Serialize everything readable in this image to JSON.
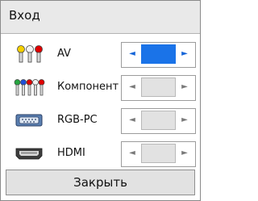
{
  "dialog": {
    "title": "Вход",
    "close_label": "Закрыть"
  },
  "inputs": [
    {
      "label": "AV",
      "icon": "av-plugs-icon",
      "selected": true
    },
    {
      "label": "Компонент",
      "icon": "component-plugs-icon",
      "selected": false
    },
    {
      "label": "RGB-PC",
      "icon": "vga-port-icon",
      "selected": false
    },
    {
      "label": "HDMI",
      "icon": "hdmi-port-icon",
      "selected": false
    }
  ],
  "arrows": {
    "left": "◄",
    "right": "►"
  },
  "colors": {
    "accent": "#1a73e8",
    "arrow_active": "#1565d8",
    "plug_yellow": "#f5d000",
    "plug_white": "#f4f4f4",
    "plug_red": "#e00000",
    "plug_green": "#26a540",
    "plug_blue": "#1f4fd8"
  }
}
